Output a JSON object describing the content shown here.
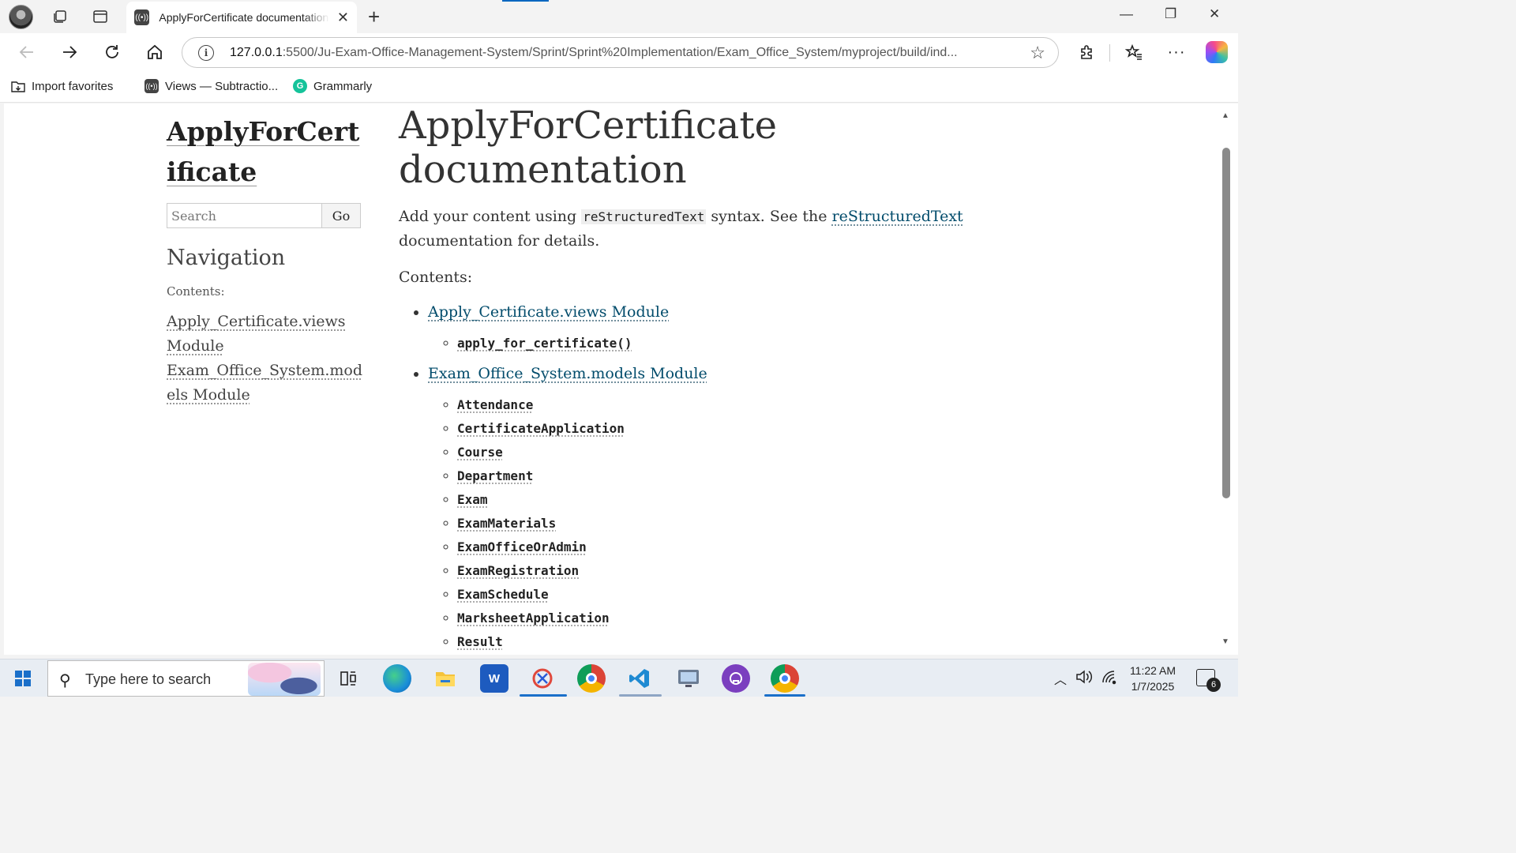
{
  "browser": {
    "tab_title": "ApplyForCertificate documentation",
    "tab_favicon": "podcast-favicon",
    "url_host": "127.0.0.1",
    "url_path": ":5500/Ju-Exam-Office-Management-System/Sprint/Sprint%20Implementation/Exam_Office_System/myproject/build/ind...",
    "favorites": [
      {
        "label": "Import favorites"
      },
      {
        "label": "Views — Subtractio..."
      },
      {
        "label": "Grammarly"
      }
    ]
  },
  "sidebar": {
    "project_title": "ApplyForCertificate",
    "search_placeholder": "Search",
    "go_label": "Go",
    "nav_heading": "Navigation",
    "contents_caption": "Contents:",
    "nav_items": [
      {
        "label": "Apply_Certificate.views Module"
      },
      {
        "label": "Exam_Office_System.models Module"
      }
    ]
  },
  "main": {
    "heading": "ApplyForCertificate documentation",
    "intro_before": "Add your content using ",
    "intro_code": "reStructuredText",
    "intro_middle": " syntax. See the ",
    "intro_link": "reStructuredText",
    "intro_after": " documentation for details.",
    "contents_caption": "Contents:",
    "toc": [
      {
        "label": "Apply_Certificate.views Module",
        "children": [
          "apply_for_certificate()"
        ]
      },
      {
        "label": "Exam_Office_System.models Module",
        "children": [
          "Attendance",
          "CertificateApplication",
          "Course",
          "Department",
          "Exam",
          "ExamMaterials",
          "ExamOfficeOrAdmin",
          "ExamRegistration",
          "ExamSchedule",
          "MarksheetApplication",
          "Result"
        ]
      }
    ]
  },
  "taskbar": {
    "search_text": "Type here to search",
    "time": "11:22 AM",
    "date": "1/7/2025",
    "notification_count": "6",
    "apps": [
      "task-view",
      "edge",
      "file-explorer",
      "word",
      "snipping-tool",
      "chrome",
      "vscode",
      "remote-desktop",
      "github-desktop",
      "chrome-profile"
    ]
  },
  "colors": {
    "link": "#004b6b",
    "accent": "#0067c0"
  }
}
